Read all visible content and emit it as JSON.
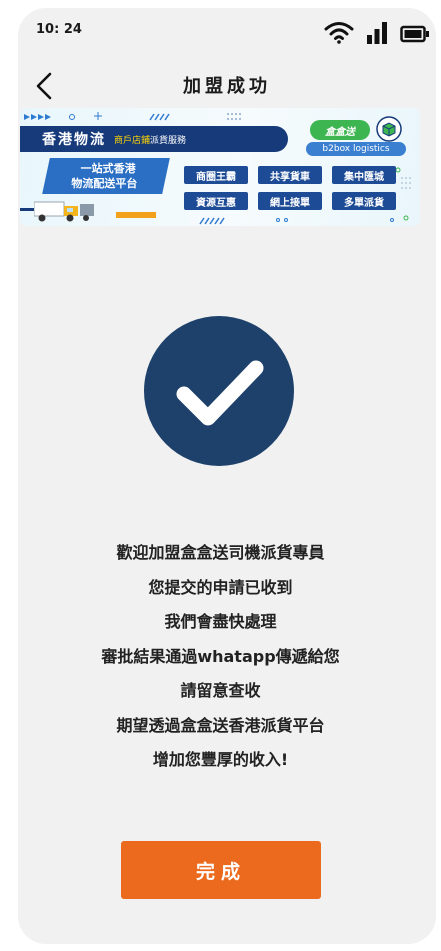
{
  "status_bar": {
    "time": "10: 24"
  },
  "nav": {
    "title": "加盟成功",
    "back_icon": "chevron-left-icon"
  },
  "banner": {
    "brand": "香港物流",
    "service_highlight": "商戶店鋪",
    "service_rest": "派貨服務",
    "tagline_line1": "一站式香港",
    "tagline_line2": "物流配送平台",
    "logo_text": "盒盒送",
    "logo_sub": "b2box logistics",
    "tags": [
      "商圈王霸",
      "共享貨車",
      "集中匯城",
      "資源互惠",
      "網上接單",
      "多單派貨"
    ],
    "colors": {
      "navy": "#173a7a",
      "blue": "#2b6fc4",
      "green": "#3db551"
    }
  },
  "success": {
    "icon": "checkmark-circle-icon",
    "color": "#1e416b"
  },
  "message": {
    "lines": [
      "歡迎加盟盒盒送司機派貨專員",
      "您提交的申請已收到",
      "我們會盡快處理",
      "審批結果通過whatapp傳遞給您",
      "請留意查收",
      "期望透過盒盒送香港派貨平台",
      "增加您豐厚的收入!"
    ]
  },
  "done_button": {
    "label": "完成",
    "color": "#ec6a1d"
  }
}
